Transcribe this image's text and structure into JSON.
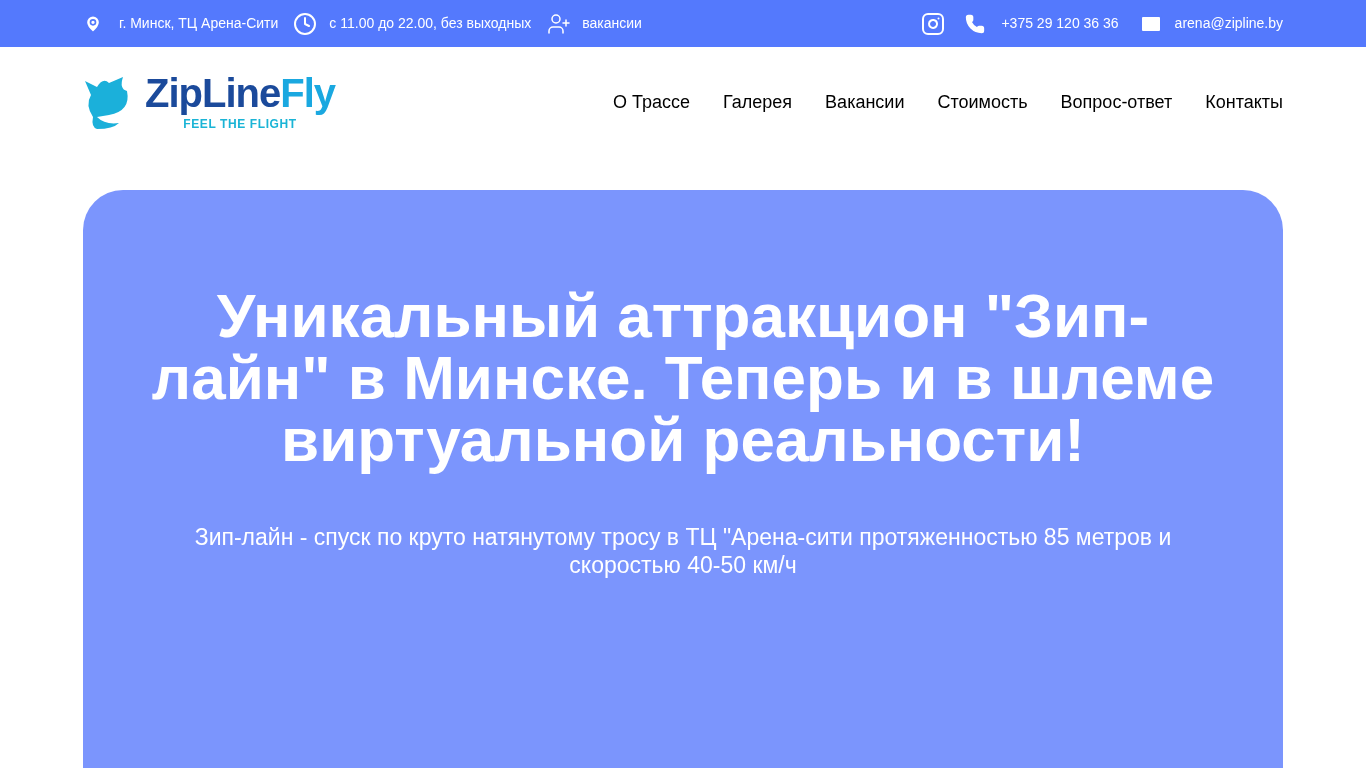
{
  "topbar": {
    "address": "г. Минск, ТЦ Арена-Сити",
    "hours": "с 11.00 до 22.00, без выходных",
    "jobs": "вакансии",
    "phone": "+375 29 120 36 36",
    "email": "arena@zipline.by"
  },
  "logo": {
    "name_main": "ZipLine",
    "name_accent": "Fly",
    "tagline": "FEEL THE FLIGHT"
  },
  "nav": [
    "О Трассе",
    "Галерея",
    "Вакансии",
    "Стоимость",
    "Вопрос-ответ",
    "Контакты"
  ],
  "hero": {
    "title": "Уникальный аттракцион \"Зип-лайн\" в Минске. Теперь и в шлеме виртуальной реальности!",
    "subtitle": "Зип-лайн - спуск по круто натянутому тросу в ТЦ \"Арена-сити протяженностью 85 метров и скоростью 40-50 км/ч"
  }
}
